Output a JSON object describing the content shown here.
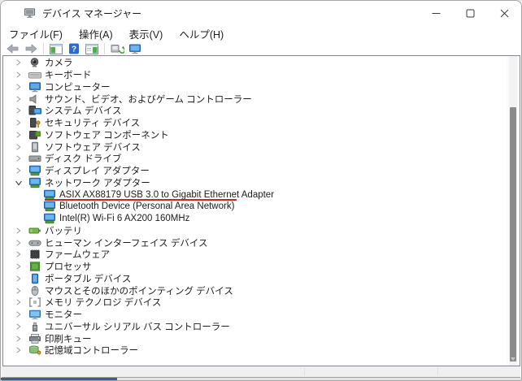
{
  "window": {
    "title": "デバイス マネージャー",
    "app_icon": "device-manager",
    "controls": [
      {
        "name": "minimize"
      },
      {
        "name": "maximize"
      },
      {
        "name": "close"
      }
    ]
  },
  "menubar": {
    "items": [
      {
        "label": "ファイル(F)"
      },
      {
        "label": "操作(A)"
      },
      {
        "label": "表示(V)"
      },
      {
        "label": "ヘルプ(H)"
      }
    ]
  },
  "toolbar": {
    "icons": [
      {
        "name": "back"
      },
      {
        "name": "forward"
      },
      {
        "name": "separator"
      },
      {
        "name": "show-console-tree"
      },
      {
        "name": "help"
      },
      {
        "name": "show-action-pane"
      },
      {
        "name": "separator"
      },
      {
        "name": "scan-hardware-changes"
      },
      {
        "name": "devices-view"
      }
    ]
  },
  "tree": {
    "items": [
      {
        "label": "カメラ",
        "icon": "camera",
        "level": 1,
        "expanded": false
      },
      {
        "label": "キーボード",
        "icon": "keyboard",
        "level": 1,
        "expanded": false
      },
      {
        "label": "コンピューター",
        "icon": "computer",
        "level": 1,
        "expanded": false
      },
      {
        "label": "サウンド、ビデオ、およびゲーム コントローラー",
        "icon": "speaker",
        "level": 1,
        "expanded": false
      },
      {
        "label": "システム デバイス",
        "icon": "system-device",
        "level": 1,
        "expanded": false
      },
      {
        "label": "セキュリティ デバイス",
        "icon": "security-device",
        "level": 1,
        "expanded": false
      },
      {
        "label": "ソフトウェア コンポーネント",
        "icon": "software-component",
        "level": 1,
        "expanded": false
      },
      {
        "label": "ソフトウェア デバイス",
        "icon": "software-device",
        "level": 1,
        "expanded": false
      },
      {
        "label": "ディスク ドライブ",
        "icon": "disk-drive",
        "level": 1,
        "expanded": false
      },
      {
        "label": "ディスプレイ アダプター",
        "icon": "adapter",
        "level": 1,
        "expanded": false
      },
      {
        "label": "ネットワーク アダプター",
        "icon": "adapter",
        "level": 1,
        "expanded": true
      },
      {
        "label": "ASIX AX88179 USB 3.0 to Gigabit Ethernet Adapter",
        "icon": "adapter",
        "level": 2,
        "underlined": true
      },
      {
        "label": "Bluetooth Device (Personal Area Network)",
        "icon": "adapter",
        "level": 2
      },
      {
        "label": "Intel(R) Wi-Fi 6 AX200 160MHz",
        "icon": "adapter",
        "level": 2
      },
      {
        "label": "バッテリ",
        "icon": "battery",
        "level": 1,
        "expanded": false
      },
      {
        "label": "ヒューマン インターフェイス デバイス",
        "icon": "hid",
        "level": 1,
        "expanded": false
      },
      {
        "label": "ファームウェア",
        "icon": "firmware",
        "level": 1,
        "expanded": false
      },
      {
        "label": "プロセッサ",
        "icon": "processor",
        "level": 1,
        "expanded": false
      },
      {
        "label": "ポータブル デバイス",
        "icon": "portable-device",
        "level": 1,
        "expanded": false
      },
      {
        "label": "マウスとそのほかのポインティング デバイス",
        "icon": "mouse",
        "level": 1,
        "expanded": false
      },
      {
        "label": "メモリ テクノロジ デバイス",
        "icon": "memory",
        "level": 1,
        "expanded": false
      },
      {
        "label": "モニター",
        "icon": "monitor",
        "level": 1,
        "expanded": false
      },
      {
        "label": "ユニバーサル シリアル バス コントローラー",
        "icon": "usb-controller",
        "level": 1,
        "expanded": false
      },
      {
        "label": "印刷キュー",
        "icon": "print-queue",
        "level": 1,
        "expanded": false
      },
      {
        "label": "記憶域コントローラー",
        "icon": "storage-controller",
        "level": 1,
        "expanded": false
      }
    ]
  },
  "annotations": {
    "underline_color": "#c9251c"
  },
  "colors": {
    "bottom_bar_blue": "#33618e"
  }
}
